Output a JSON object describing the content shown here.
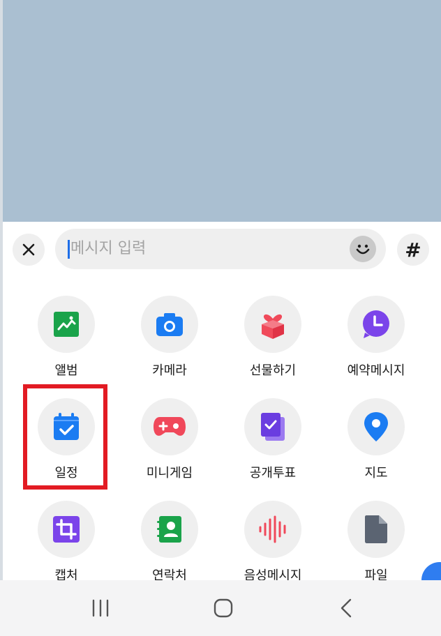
{
  "input": {
    "placeholder": "메시지 입력"
  },
  "icons": {
    "close": "close-icon",
    "emoji": "emoji-icon",
    "hashtag": "#"
  },
  "menu": [
    {
      "label": "앨범",
      "icon": "album-icon",
      "color": "#1aa34a"
    },
    {
      "label": "카메라",
      "icon": "camera-icon",
      "color": "#1b7cf2"
    },
    {
      "label": "선물하기",
      "icon": "gift-icon",
      "color": "#f04a5a"
    },
    {
      "label": "예약메시지",
      "icon": "scheduled-message-icon",
      "color": "#7b44ea"
    },
    {
      "label": "일정",
      "icon": "calendar-icon",
      "color": "#1b7cf2"
    },
    {
      "label": "미니게임",
      "icon": "gamepad-icon",
      "color": "#f0485a"
    },
    {
      "label": "공개투표",
      "icon": "poll-icon",
      "color": "#6a3de0"
    },
    {
      "label": "지도",
      "icon": "map-pin-icon",
      "color": "#1b7cf2"
    },
    {
      "label": "캡처",
      "icon": "capture-icon",
      "color": "#7b44ea"
    },
    {
      "label": "연락처",
      "icon": "contact-icon",
      "color": "#1aa34a"
    },
    {
      "label": "음성메시지",
      "icon": "voice-message-icon",
      "color": "#f0485a"
    },
    {
      "label": "파일",
      "icon": "file-icon",
      "color": "#5b6472"
    }
  ],
  "highlight_color": "#e21b23",
  "nav": {
    "recents": "recents-icon",
    "home": "home-icon",
    "back": "back-icon"
  }
}
